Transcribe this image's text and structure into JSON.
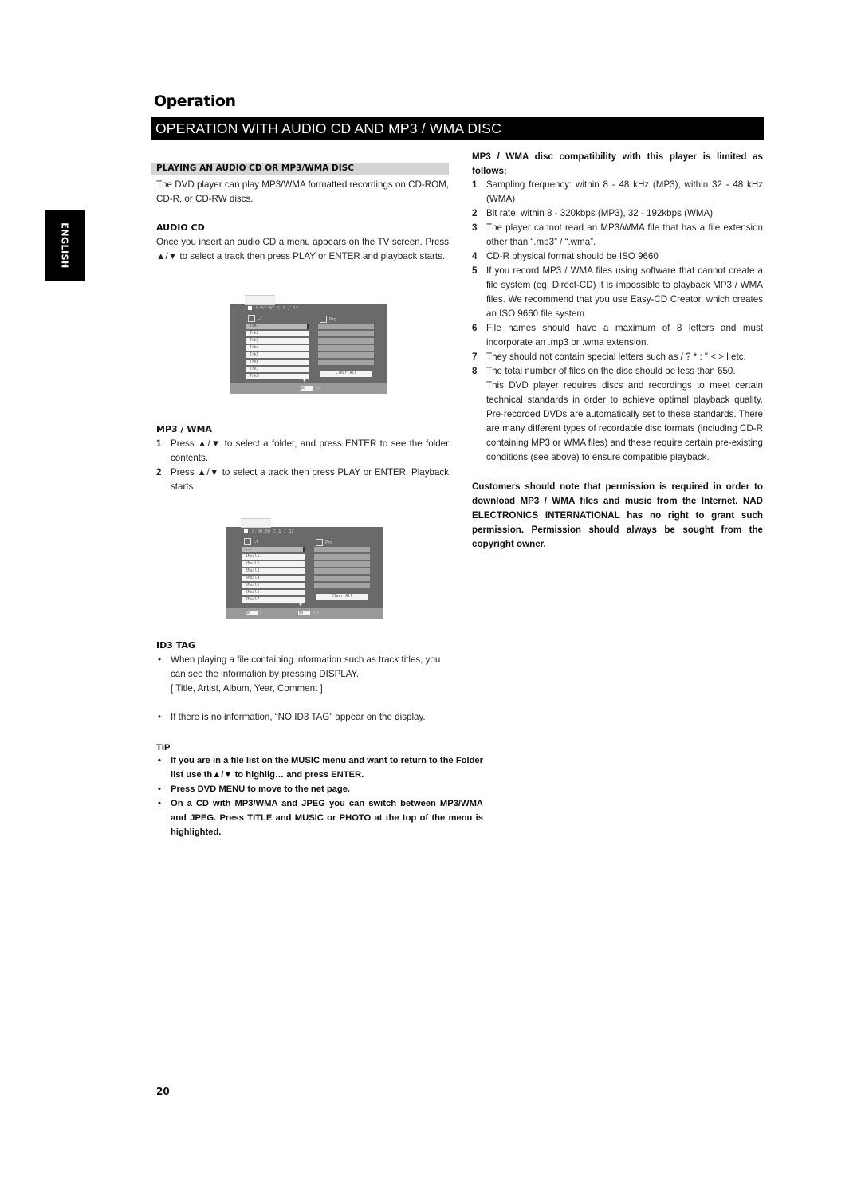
{
  "chapter_title": "Operation",
  "banner_title": "OPERATION WITH AUDIO CD AND MP3 / WMA DISC",
  "side_tab": "ENGLISH",
  "page_number": "20",
  "left": {
    "section_header": "PLAYING AN AUDIO CD OR MP3/WMA DISC",
    "intro": "The DVD player can play MP3/WMA formatted recordings on CD-ROM, CD-R, or CD-RW discs.",
    "audio_cd": {
      "heading": "AUDIO CD",
      "text": "Once you insert an audio CD a menu appears on the TV screen. Press ▲/▼ to select a track then press PLAY or ENTER and playback starts."
    },
    "audio_menu": {
      "time": "0:52:07",
      "count": "1 / 12",
      "list_label": "Lt",
      "program_label": "Prg",
      "tracks": [
        "Trk1",
        "Trk2",
        "Trk3",
        "Trk4",
        "Trk5",
        "Trk6",
        "Trk7",
        "Trk8"
      ],
      "clear_label": "Clear All",
      "footer_button": "ON",
      "footer_text": "Ext"
    },
    "mp3_wma": {
      "heading": "MP3 / WMA",
      "steps": [
        {
          "n": "1",
          "text": "Press ▲/▼ to select a folder, and press ENTER to see the folder contents."
        },
        {
          "n": "2",
          "text": "Press ▲/▼ to select a track then press PLAY or ENTER. Playback starts."
        }
      ]
    },
    "mp3_menu": {
      "time": "0:00:00",
      "count": "1 / 12",
      "list_label": "Lt",
      "program_label": "Prg",
      "tracks": [
        "..",
        "1Mail1",
        "2Mail2",
        "3Mail3",
        "4Mail4",
        "5Mail5",
        "6Mail6",
        "7Mail7"
      ],
      "clear_label": "Clear All",
      "footer_button_1": "ON",
      "footer_text_1": "P",
      "footer_button_2": "ON",
      "footer_text_2": "Ext"
    },
    "id3": {
      "heading": "ID3 TAG",
      "bullets": [
        "When playing a file containing information such as track titles, you can see the information by pressing DISPLAY.",
        "If there is no information, “NO ID3 TAG” appear on the display."
      ],
      "fields_line": "[ Title, Artist, Album, Year, Comment ]"
    },
    "tip": {
      "heading": "TIP",
      "bullets": [
        "If you are in a file list on the MUSIC menu and want to return to the Folder list use th▲/▼   to highlig…   and press ENTER.",
        "Press DVD MENU to move to the net page.",
        "On a CD with MP3/WMA and JPEG you can switch between MP3/WMA and JPEG. Press TITLE and MUSIC or PHOTO at the top of the menu is highlighted."
      ]
    }
  },
  "right": {
    "compat_heading": "MP3 / WMA disc compatibility with this player is limited as follows:",
    "items": [
      {
        "n": "1",
        "text": "Sampling frequency: within 8 - 48 kHz (MP3), within 32 - 48 kHz (WMA)"
      },
      {
        "n": "2",
        "text": "Bit rate: within 8 - 320kbps (MP3), 32 - 192kbps (WMA)"
      },
      {
        "n": "3",
        "text": "The player cannot read an MP3/WMA file that has a file extension other than “.mp3” / “.wma”."
      },
      {
        "n": "4",
        "text": "CD-R physical format should be ISO 9660"
      },
      {
        "n": "5",
        "text": "If you record MP3 / WMA files using software that cannot create a file system (eg. Direct-CD) it is impossible to playback MP3 / WMA files. We recommend that you use Easy-CD Creator, which creates an ISO 9660 file system."
      },
      {
        "n": "6",
        "text": "File names should have a maximum of 8 letters and must incorporate an .mp3 or .wma extension."
      },
      {
        "n": "7",
        "text": "They should not contain special letters such as  / ? * : \" < > l etc."
      },
      {
        "n": "8",
        "text": "The total number of files on the disc should be less than 650."
      }
    ],
    "standards_para": "This DVD player requires discs and recordings to meet certain technical standards in order to achieve optimal playback quality. Pre-recorded DVDs are automatically set to these standards. There are many different types of recordable disc formats (including CD-R containing MP3 or WMA files) and these require certain pre-existing conditions (see above) to ensure compatible playback.",
    "permission_note": "Customers should note that permission is required in order to download MP3 / WMA files and music from the Internet. NAD ELECTRONICS INTERNATIONAL has no right to grant such permission. Permission should always be sought from the copyright owner."
  }
}
